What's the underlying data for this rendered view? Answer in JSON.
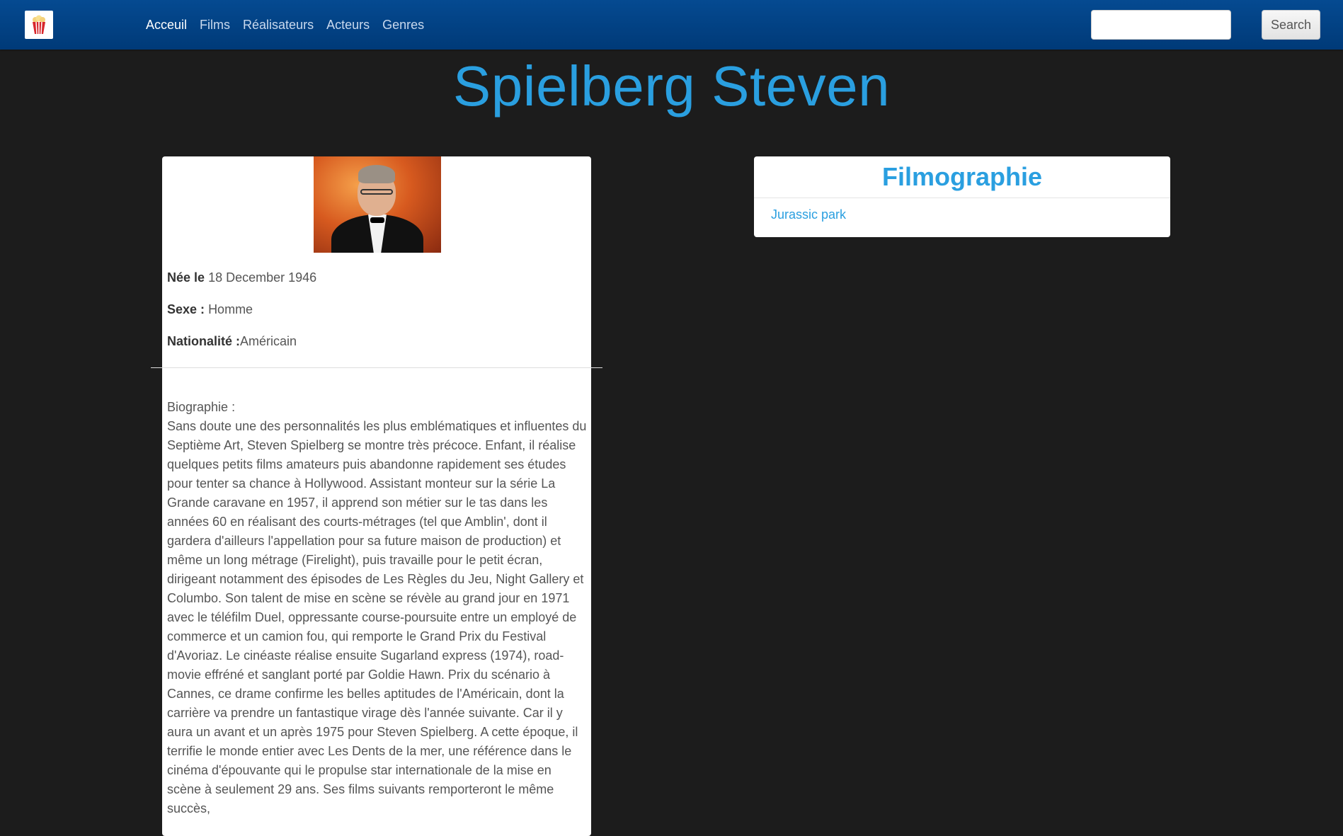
{
  "navbar": {
    "brand_icon": "popcorn-icon",
    "links": [
      "Acceuil",
      "Films",
      "Réalisateurs",
      "Acteurs",
      "Genres"
    ],
    "active": "Acceuil",
    "search_value": "",
    "search_button": "Search"
  },
  "page": {
    "title": "Spielberg Steven"
  },
  "profile": {
    "birth_label": "Née le",
    "birth_value": "18 December 1946",
    "sex_label": "Sexe :",
    "sex_value": "Homme",
    "nationality_label": "Nationalité :",
    "nationality_value": "Américain",
    "bio_label": "Biographie :",
    "bio_text": "Sans doute une des personnalités les plus emblématiques et influentes du Septième Art, Steven Spielberg se montre très précoce. Enfant, il réalise quelques petits films amateurs puis abandonne rapidement ses études pour tenter sa chance à Hollywood. Assistant monteur sur la série La Grande caravane en 1957, il apprend son métier sur le tas dans les années 60 en réalisant des courts-métrages (tel que Amblin', dont il gardera d'ailleurs l'appellation pour sa future maison de production) et même un long métrage (Firelight), puis travaille pour le petit écran, dirigeant notamment des épisodes de Les Règles du Jeu, Night Gallery et Columbo. Son talent de mise en scène se révèle au grand jour en 1971 avec le téléfilm Duel, oppressante course-poursuite entre un employé de commerce et un camion fou, qui remporte le Grand Prix du Festival d'Avoriaz. Le cinéaste réalise ensuite Sugarland express (1974), road-movie effréné et sanglant porté par Goldie Hawn. Prix du scénario à Cannes, ce drame confirme les belles aptitudes de l'Américain, dont la carrière va prendre un fantastique virage dès l'année suivante. Car il y aura un avant et un après 1975 pour Steven Spielberg. A cette époque, il terrifie le monde entier avec Les Dents de la mer, une référence dans le cinéma d'épouvante qui le propulse star internationale de la mise en scène à seulement 29 ans. Ses films suivants remporteront le même succès,"
  },
  "filmography": {
    "title": "Filmographie",
    "films": [
      "Jurassic park"
    ]
  },
  "colors": {
    "navbar": "#054a91",
    "background": "#1c1c1c",
    "accent": "#2a9fe0"
  }
}
